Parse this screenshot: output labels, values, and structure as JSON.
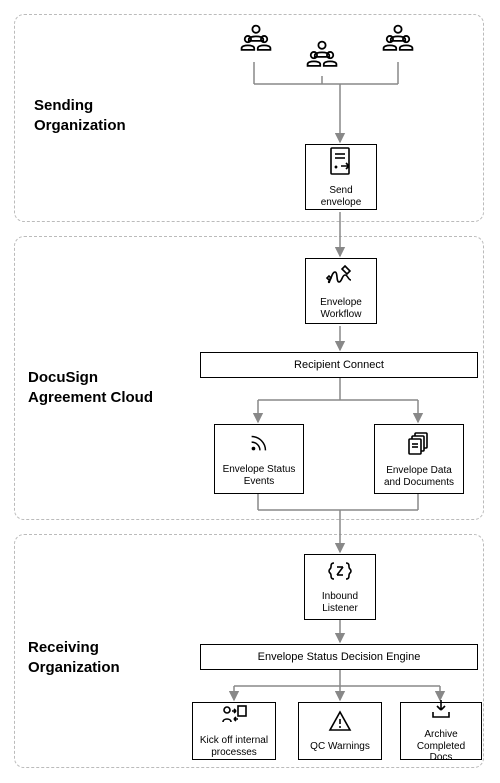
{
  "sections": {
    "sending_label": "Sending Organization",
    "cloud_label": "DocuSign Agreement Cloud",
    "receiving_label": "Receiving Organization"
  },
  "nodes": {
    "send_envelope": "Send envelope",
    "envelope_workflow": "Envelope Workflow",
    "recipient_connect": "Recipient Connect",
    "status_events": "Envelope Status Events",
    "data_docs": "Envelope Data and Documents",
    "inbound_listener": "Inbound Listener",
    "decision_engine": "Envelope Status Decision Engine",
    "kickoff": "Kick off internal processes",
    "qc": "QC Warnings",
    "archive": "Archive Completed Docs"
  },
  "icons": {
    "users1": "users-icon",
    "users2": "users-icon",
    "users3": "users-icon",
    "doc": "document-arrow-icon",
    "signature": "signature-icon",
    "broadcast": "broadcast-icon",
    "docs_stack": "documents-stack-icon",
    "listener": "code-braces-icon",
    "kickoff": "process-transfer-icon",
    "warning": "warning-triangle-icon",
    "archive": "download-archive-icon"
  }
}
